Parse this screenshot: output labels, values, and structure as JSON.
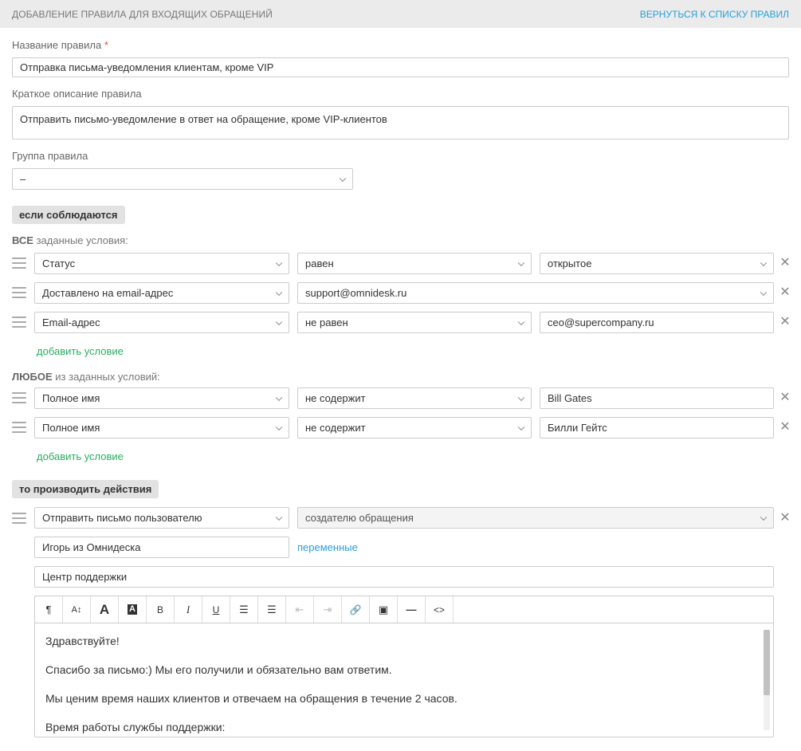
{
  "header": {
    "title": "ДОБАВЛЕНИЕ ПРАВИЛА ДЛЯ ВХОДЯЩИХ ОБРАЩЕНИЙ",
    "back_link": "ВЕРНУТЬСЯ К СПИСКУ ПРАВИЛ"
  },
  "form": {
    "name_label": "Название правила",
    "name_required_mark": "*",
    "name_value": "Отправка письма-уведомления клиентам, кроме VIP",
    "description_label": "Краткое описание правила",
    "description_value": "Отправить письмо-уведомление в ответ на обращение, кроме VIP-клиентов",
    "group_label": "Группа правила",
    "group_value": "–"
  },
  "conditions": {
    "badge": "если соблюдаются",
    "all_prefix": "ВСЕ",
    "all_suffix": "заданные условия:",
    "all_rows": [
      {
        "field": "Статус",
        "operator": "равен",
        "value": "открытое"
      },
      {
        "field": "Доставлено на email-адрес",
        "operator": "support@omnidesk.ru"
      },
      {
        "field": "Email-адрес",
        "operator": "не равен",
        "value": "ceo@supercompany.ru"
      }
    ],
    "add_condition_1": "добавить условие",
    "any_prefix": "ЛЮБОЕ",
    "any_suffix": "из заданных условий:",
    "any_rows": [
      {
        "field": "Полное имя",
        "operator": "не содержит",
        "value": "Bill Gates"
      },
      {
        "field": "Полное имя",
        "operator": "не содержит",
        "value": "Билли Гейтс"
      }
    ],
    "add_condition_2": "добавить условие"
  },
  "actions": {
    "badge": "то производить действия",
    "action": "Отправить письмо пользователю",
    "recipient": "создателю обращения",
    "sender_name": "Игорь из Омнидеска",
    "variables_link": "переменные",
    "subject": "Центр поддержки",
    "toolbar": [
      {
        "icon": "paragraph-icon",
        "glyph": "¶"
      },
      {
        "icon": "font-size-icon",
        "glyph": "A↕"
      },
      {
        "icon": "font-color-icon",
        "glyph": "A"
      },
      {
        "icon": "background-color-icon",
        "glyph": "A"
      },
      {
        "icon": "bold-icon",
        "glyph": "B"
      },
      {
        "icon": "italic-icon",
        "glyph": "I"
      },
      {
        "icon": "underline-icon",
        "glyph": "U"
      },
      {
        "icon": "bullet-list-icon",
        "glyph": "☰"
      },
      {
        "icon": "numbered-list-icon",
        "glyph": "☰"
      },
      {
        "icon": "outdent-icon",
        "glyph": "⇤"
      },
      {
        "icon": "indent-icon",
        "glyph": "⇥"
      },
      {
        "icon": "link-icon",
        "glyph": "🔗"
      },
      {
        "icon": "image-icon",
        "glyph": "▣"
      },
      {
        "icon": "horizontal-rule-icon",
        "glyph": "—"
      },
      {
        "icon": "code-icon",
        "glyph": "<>"
      }
    ],
    "body_lines": [
      "Здравствуйте!",
      "Спасибо за письмо:) Мы его получили и обязательно вам ответим.",
      "Мы ценим время наших клиентов и отвечаем на обращения в течение 2 часов.",
      "Время работы службы поддержки:"
    ]
  }
}
